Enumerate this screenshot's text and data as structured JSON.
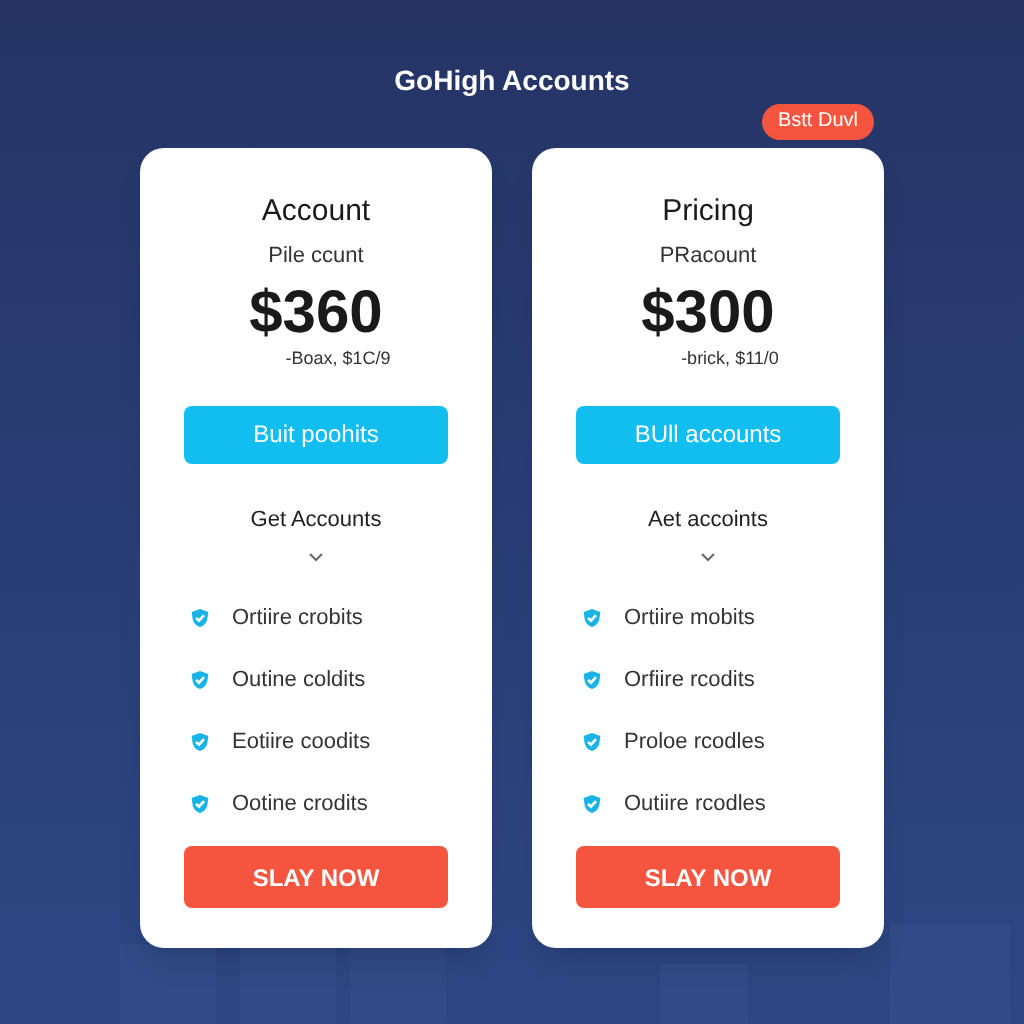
{
  "header": {
    "title": "GoHigh Accounts",
    "badge": "Bstt Duvl"
  },
  "plans": [
    {
      "name": "Account",
      "subtitle": "Pile ccunt",
      "price": "$360",
      "price_note": "-Boax, $1C/9",
      "primary_button": "Buit poohits",
      "section_label": "Get Accounts",
      "features": [
        "Ortiire crobits",
        "Outine coldits",
        "Eotiire coodits",
        "Ootine crodits"
      ],
      "cta": "SLAY NOW"
    },
    {
      "name": "Pricing",
      "subtitle": "PRacount",
      "price": "$300",
      "price_note": "-brick, $11/0",
      "primary_button": "BUll accounts",
      "section_label": "Aet accoints",
      "features": [
        "Ortiire mobits",
        "Orfiire rcodits",
        "Proloe rcodles",
        "Outiire rcodles"
      ],
      "cta": "SLAY NOW"
    }
  ]
}
